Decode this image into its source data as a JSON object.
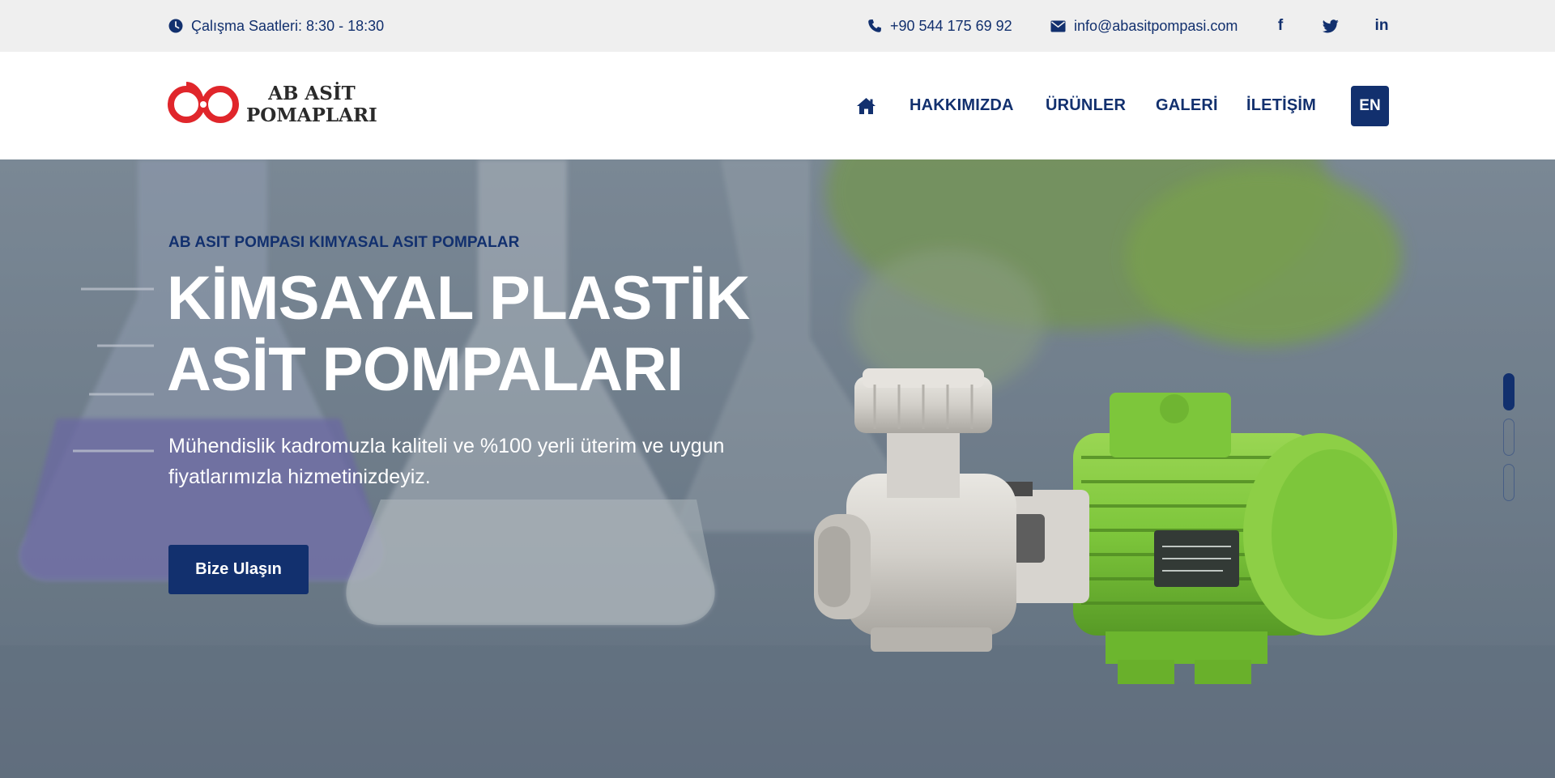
{
  "topbar": {
    "hours": "Çalışma Saatleri: 8:30 - 18:30",
    "phone": "+90 544 175 69 92",
    "email": "info@abasitpompasi.com",
    "social": [
      {
        "icon": "facebook-icon",
        "glyph": "f"
      },
      {
        "icon": "twitter-icon",
        "glyph": "t"
      },
      {
        "icon": "linkedin-icon",
        "glyph": "in"
      }
    ]
  },
  "header": {
    "logo_line1": "AB ASİT",
    "logo_line2": "POMAPLARI",
    "nav": {
      "home_icon": "home-icon",
      "about": "HAKKIMIZDA",
      "products": "ÜRÜNLER",
      "gallery": "GALERİ",
      "contact": "İLETİŞİM"
    },
    "language": "EN"
  },
  "hero": {
    "kicker": "AB ASIT POMPASI KIMYASAL ASIT POMPALAR",
    "title": "KİMSAYAL PLASTİK ASİT POMPALARI",
    "description": "Mühendislik kadromuzla kaliteli ve %100 yerli üterim ve uygun fiyatlarımızla hizmetinizdeyiz.",
    "cta": "Bize Ulaşın",
    "slides_total": 3,
    "slide_active": 1
  },
  "colors": {
    "brand_navy": "#12306e",
    "logo_red": "#e0262b",
    "topbar_bg": "#efefef",
    "pump_green": "#7dc63b"
  }
}
